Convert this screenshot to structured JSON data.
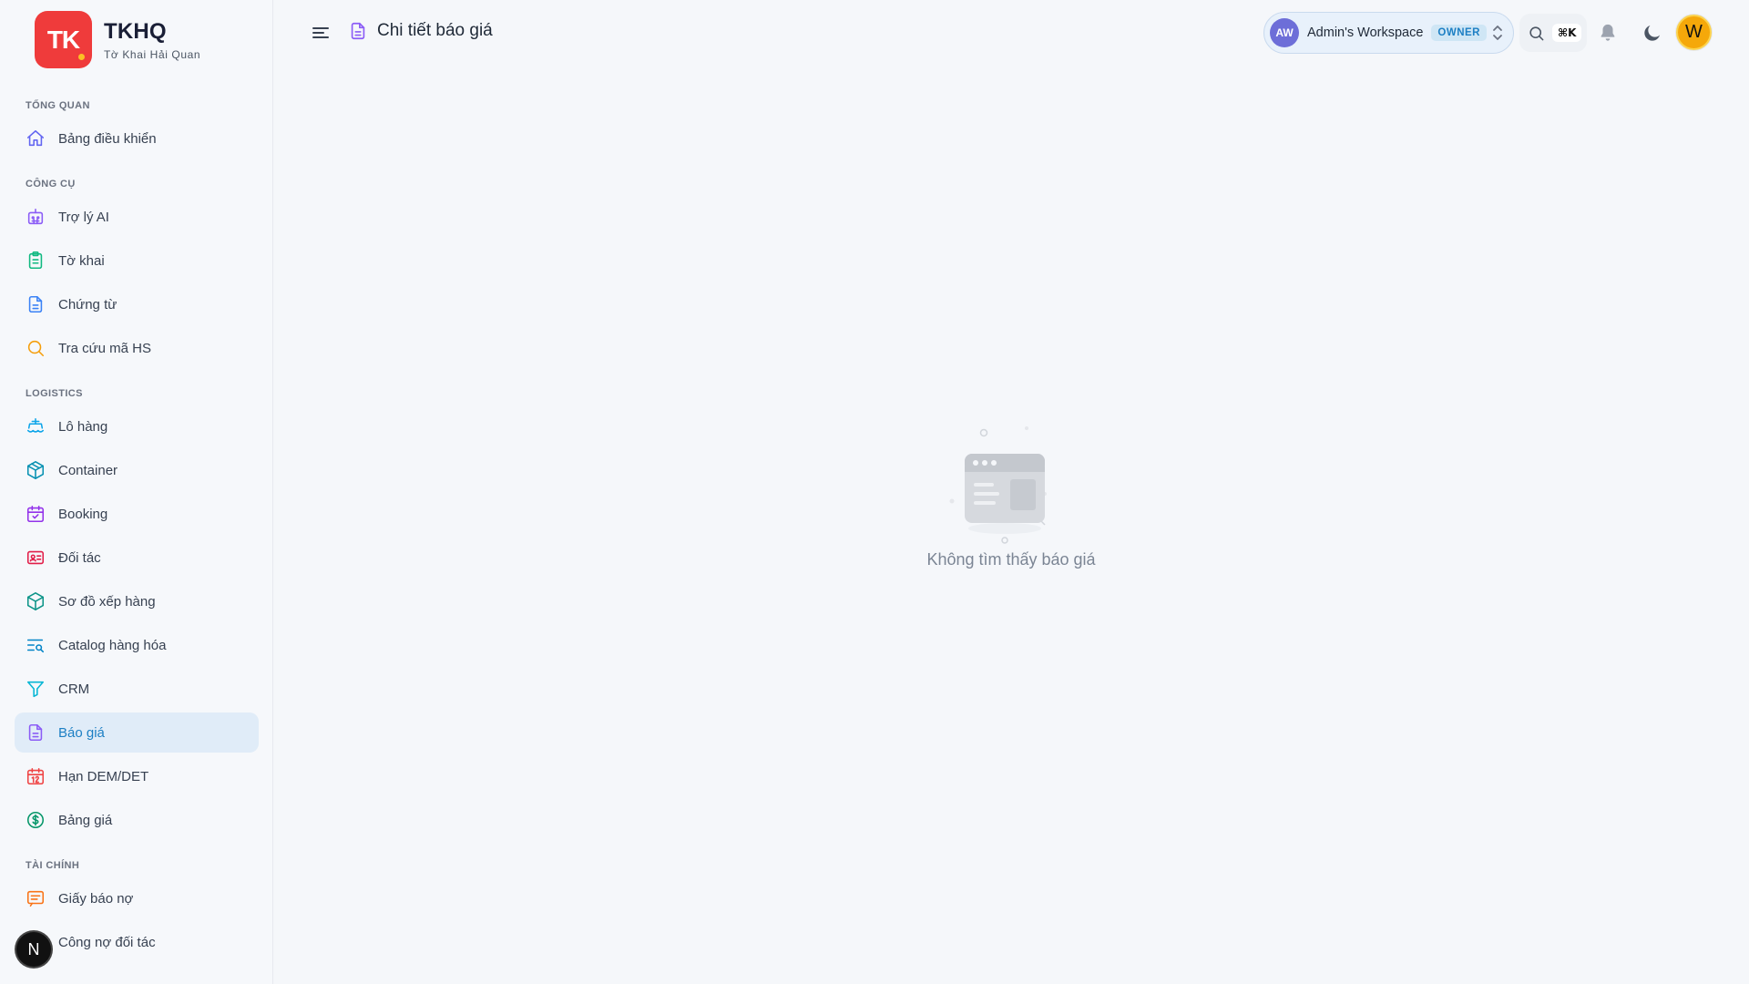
{
  "brand": {
    "logo_text": "TK",
    "name": "TKHQ",
    "subtitle": "Tờ Khai Hải Quan"
  },
  "sidebar": {
    "sections": [
      {
        "title": "TỔNG QUAN",
        "items": [
          {
            "label": "Bảng điều khiển",
            "icon": "home-icon",
            "color": "#6366f1"
          }
        ]
      },
      {
        "title": "CÔNG CỤ",
        "items": [
          {
            "label": "Trợ lý AI",
            "icon": "bot-icon",
            "color": "#8b5cf6"
          },
          {
            "label": "Tờ khai",
            "icon": "clipboard-icon",
            "color": "#10b981"
          },
          {
            "label": "Chứng từ",
            "icon": "file-text-icon",
            "color": "#3b82f6"
          },
          {
            "label": "Tra cứu mã HS",
            "icon": "search-icon",
            "color": "#f59e0b"
          }
        ]
      },
      {
        "title": "LOGISTICS",
        "items": [
          {
            "label": "Lô hàng",
            "icon": "ship-icon",
            "color": "#0ea5e9"
          },
          {
            "label": "Container",
            "icon": "box-icon",
            "color": "#0891b2"
          },
          {
            "label": "Booking",
            "icon": "calendar-check-icon",
            "color": "#9333ea"
          },
          {
            "label": "Đối tác",
            "icon": "contact-card-icon",
            "color": "#e11d48"
          },
          {
            "label": "Sơ đồ xếp hàng",
            "icon": "cube-icon",
            "color": "#0d9488"
          },
          {
            "label": "Catalog hàng hóa",
            "icon": "list-search-icon",
            "color": "#0284c7"
          },
          {
            "label": "CRM",
            "icon": "funnel-icon",
            "color": "#06b6d4"
          },
          {
            "label": "Báo giá",
            "icon": "file-text-icon",
            "color": "#8b5cf6",
            "active": true
          },
          {
            "label": "Hạn DEM/DET",
            "icon": "calendar-12-icon",
            "color": "#ef4444"
          },
          {
            "label": "Bảng giá",
            "icon": "dollar-circle-icon",
            "color": "#059669"
          }
        ]
      },
      {
        "title": "TÀI CHÍNH",
        "items": [
          {
            "label": "Giấy báo nợ",
            "icon": "message-lines-icon",
            "color": "#f97316"
          },
          {
            "label": "Công nợ đối tác",
            "icon": "wallet-icon",
            "color": "#6366f1"
          }
        ]
      }
    ],
    "floating_badge": "N"
  },
  "header": {
    "title": "Chi tiết báo giá",
    "workspace": {
      "initials": "AW",
      "name": "Admin's Workspace",
      "role": "OWNER"
    },
    "search_shortcut": "⌘K",
    "user_initial": "W"
  },
  "main": {
    "empty_message": "Không tìm thấy báo giá"
  },
  "colors": {
    "accent": "#1c7fc4",
    "active_bg": "#e0ecf8",
    "logo": "#ef3b3b"
  }
}
